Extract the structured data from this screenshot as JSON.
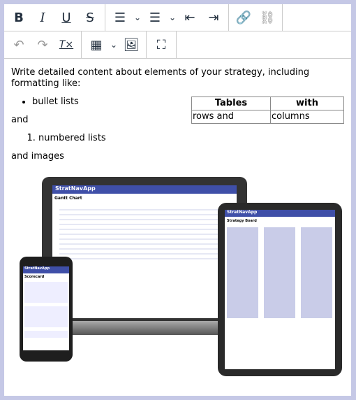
{
  "toolbar": {
    "row1": [
      {
        "name": "bold",
        "label": "B"
      },
      {
        "name": "italic",
        "label": "I"
      },
      {
        "name": "underline",
        "label": "U"
      },
      {
        "name": "strikethrough",
        "label": "S"
      }
    ],
    "icons": {
      "bullet": "☰",
      "numbered": "☰",
      "outdent": "⇤",
      "indent": "⇥",
      "link": "🔗",
      "unlink": "⛓",
      "undo": "↶",
      "redo": "↷",
      "clear": "T×",
      "table": "▦",
      "image": "🖼",
      "fullscreen": "⛶",
      "chevron": "⌄"
    }
  },
  "content": {
    "intro": "Write detailed content about elements of your strategy, including formatting like:",
    "bullet_item": "bullet lists",
    "and1": "and",
    "numbered_item": "numbered lists",
    "and2": "and images",
    "table": {
      "header": [
        "Tables",
        "with"
      ],
      "row": [
        "rows and",
        "columns"
      ]
    }
  },
  "image": {
    "app_name": "StratNavApp",
    "laptop_title": "Gantt Chart",
    "tablet_title": "Strategy Board",
    "phone_title": "Scorecard",
    "brand_color": "#3f4fa8"
  }
}
